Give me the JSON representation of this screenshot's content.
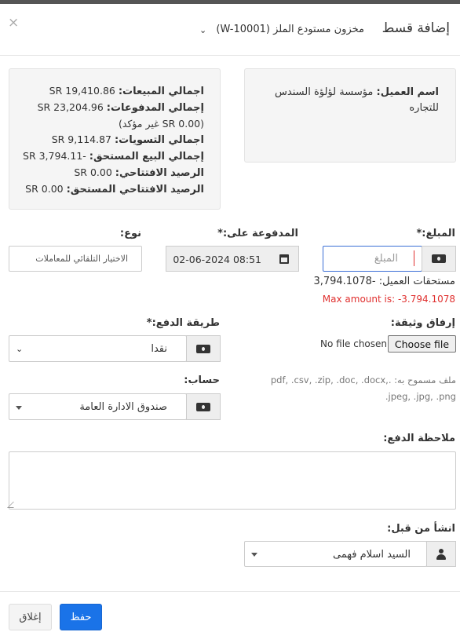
{
  "modal": {
    "title": "إضافة قسط",
    "close_symbol": "×",
    "location_value": "مخزون مستودع الملز (W-10001)"
  },
  "customer": {
    "name_label": "اسم العميل:",
    "name_value": "مؤسسة لؤلؤة السندس للتجاره"
  },
  "summary": {
    "total_sales_label": "اجمالي المبيعات:",
    "total_sales_value": "SR 19,410.86",
    "total_paid_label": "إجمالي المدفوعات:",
    "total_paid_value": "SR 23,204.96",
    "unconfirmed_value": "(0.00 SR غير مؤكد)",
    "total_adjustments_label": "اجمالي التسويات:",
    "total_adjustments_value": "SR 9,114.87",
    "total_sell_due_label": "إجمالي البيع المستحق:",
    "total_sell_due_value": "SR 3,794.11-",
    "opening_balance_label": "الرصيد الافتتاحي:",
    "opening_balance_value": "SR 0.00",
    "opening_balance_due_label": "الرصيد الافتتاحي المستحق:",
    "opening_balance_due_value": "SR 0.00"
  },
  "amount": {
    "label": "المبلغ:*",
    "placeholder": "المبلغ",
    "customer_due_label": "مستحقات العميل:",
    "customer_due_value": "3,794.1078-",
    "max_amount_error": "Max amount is: -3.794.1078"
  },
  "paid_on": {
    "label": "المدفوعة على:*",
    "value": "02-06-2024 08:51"
  },
  "type": {
    "label": "نوع:",
    "selected": "الاختيار التلقائي للمعاملات"
  },
  "attach": {
    "label": "إرفاق وثيقة:",
    "button": "Choose file",
    "no_file": "No file chosen",
    "allowed_note": "ملف مسموح به: .pdf, .csv, .zip, .doc, .docx, .jpeg, .jpg, .png"
  },
  "payment_method": {
    "label": "طريقة الدفع:*",
    "selected": "نقدا"
  },
  "account": {
    "label": "حساب:",
    "selected": "صندوق الادارة العامة"
  },
  "note": {
    "label": "ملاحظة الدفع:",
    "value": ""
  },
  "created_by": {
    "label": "انشأ من قبل:",
    "selected": "السيد اسلام فهمى"
  },
  "footer": {
    "save": "حفظ",
    "close": "إغلاق"
  },
  "colors": {
    "primary": "#1a73e8",
    "error": "#e0302f",
    "well_bg": "#f5f5f5"
  }
}
